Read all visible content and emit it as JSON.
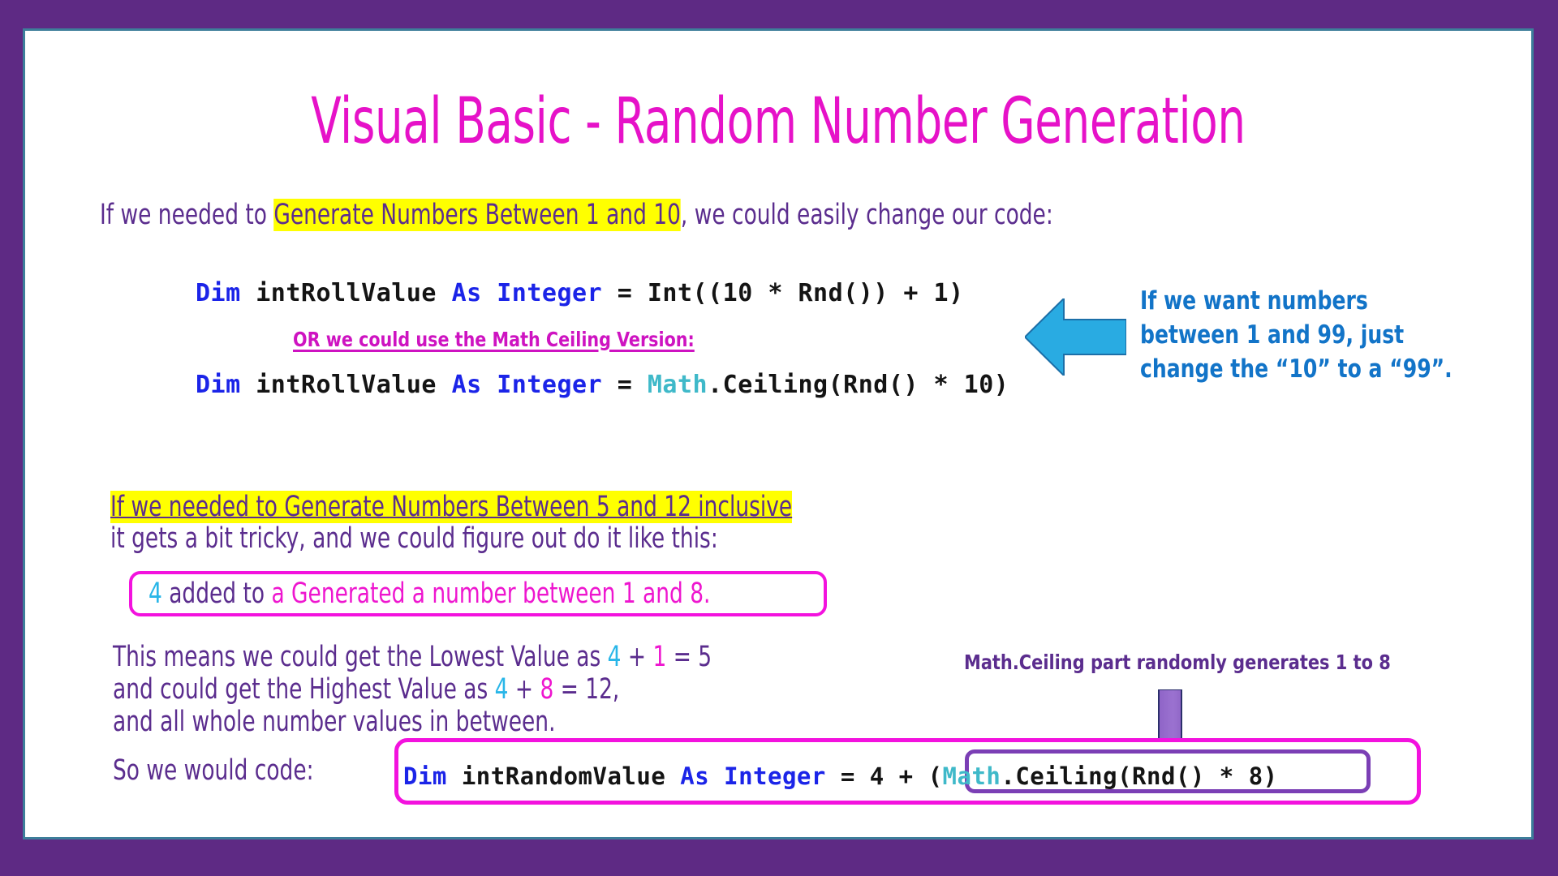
{
  "slide": {
    "title": "Visual Basic - Random Number Generation",
    "background_color": "#5E2A84",
    "canvas_color": "#ffffff",
    "border_color": "#3D7E9A"
  },
  "intro": {
    "before": "If we needed to ",
    "highlight": "Generate Numbers Between 1 and 10",
    "after": ", we could easily change our code:"
  },
  "code_1": {
    "kw_dim": "Dim",
    "var": " intRollValue ",
    "kw_as": "As Integer",
    "rest": " = Int((10 * Rnd()) + 1)"
  },
  "or_line": {
    "text": "OR we could use the Math Ceiling Version:"
  },
  "code_2": {
    "kw_dim": "Dim",
    "var": " intRollValue ",
    "kw_as": "As Integer",
    "eq": " = ",
    "cls": "Math",
    "rest": ".Ceiling(Rnd() * 10)"
  },
  "blue_callout": {
    "line_1": "If we want numbers",
    "line_2": "between 1 and 99, just",
    "line_3": "change the “10” to a “99”.",
    "color": "#1274C8",
    "arrow_color": "#29ABE2",
    "arrow_direction": "left"
  },
  "tricky": {
    "line_1_highlight": "If we needed to Generate Numbers Between 5 and 12 inclusive",
    "line_2": "it gets a bit tricky, and we could figure out do it like this:"
  },
  "added_box": {
    "num": "4",
    "mid": " added to ",
    "tail": "a Generated a number between 1 and 8.",
    "border_color": "#F312DE"
  },
  "means": {
    "l1_a": "This means we could get the Lowest Value as ",
    "l1_num1": "4",
    "l1_plus": " + ",
    "l1_num2": "1",
    "l1_end": " = 5",
    "l2_a": "and could get the Highest Value as ",
    "l2_num1": "4",
    "l2_plus": " + ",
    "l2_num2": "8",
    "l2_end": " = 12,",
    "l3": "and all whole number values in between."
  },
  "ceiling_note": {
    "text": "Math.Ceiling part randomly generates 1 to 8",
    "color": "#5B2D8E",
    "arrow_color": "#8B5FC4",
    "arrow_direction": "down"
  },
  "so_we_code": {
    "label": "So we would code:"
  },
  "code_3": {
    "kw_dim": "Dim",
    "var": " intRandomValue ",
    "kw_as": "As Integer",
    "eq": " = 4 + (",
    "cls": "Math",
    "rest": ".Ceiling(Rnd() * 8)",
    "outer_border_color": "#F312DE",
    "inner_border_color": "#7B3FB5"
  },
  "colors": {
    "title": "#E612C8",
    "body_text": "#5B2D8E",
    "highlight": "#FFFF00",
    "keyword": "#1B24E8",
    "class": "#3FB9C9",
    "cyan": "#29B6E8",
    "magenta": "#EE16CF"
  }
}
